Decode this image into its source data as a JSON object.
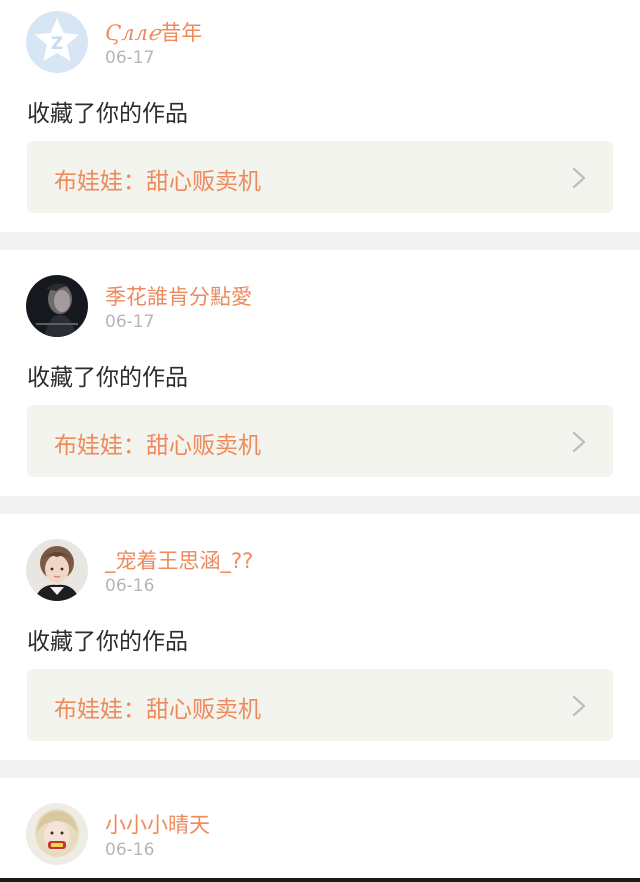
{
  "notifications": [
    {
      "username_name": "Ϛллℯ",
      "username_suffix": "昔年",
      "date": "06-17",
      "action": "收藏了你的作品",
      "work_title": "布娃娃：甜心贩卖机",
      "avatar": "default-star-avatar-icon"
    },
    {
      "username": "季花誰肯分點愛",
      "date": "06-17",
      "action": "收藏了你的作品",
      "work_title": "布娃娃：甜心贩卖机",
      "avatar": "dark-portrait-avatar"
    },
    {
      "username": "_宠着王思涵_??",
      "date": "06-16",
      "action": "收藏了你的作品",
      "work_title": "布娃娃：甜心贩卖机",
      "avatar": "girl-portrait-avatar"
    },
    {
      "username": "小小小晴天",
      "date": "06-16",
      "avatar": "blonde-portrait-avatar"
    }
  ],
  "colors": {
    "username": "#ee8a5c",
    "date": "#b6b6b6",
    "action_text": "#2c2c2c",
    "link_background": "#f4f4ee",
    "separator": "#f3f3f3"
  }
}
